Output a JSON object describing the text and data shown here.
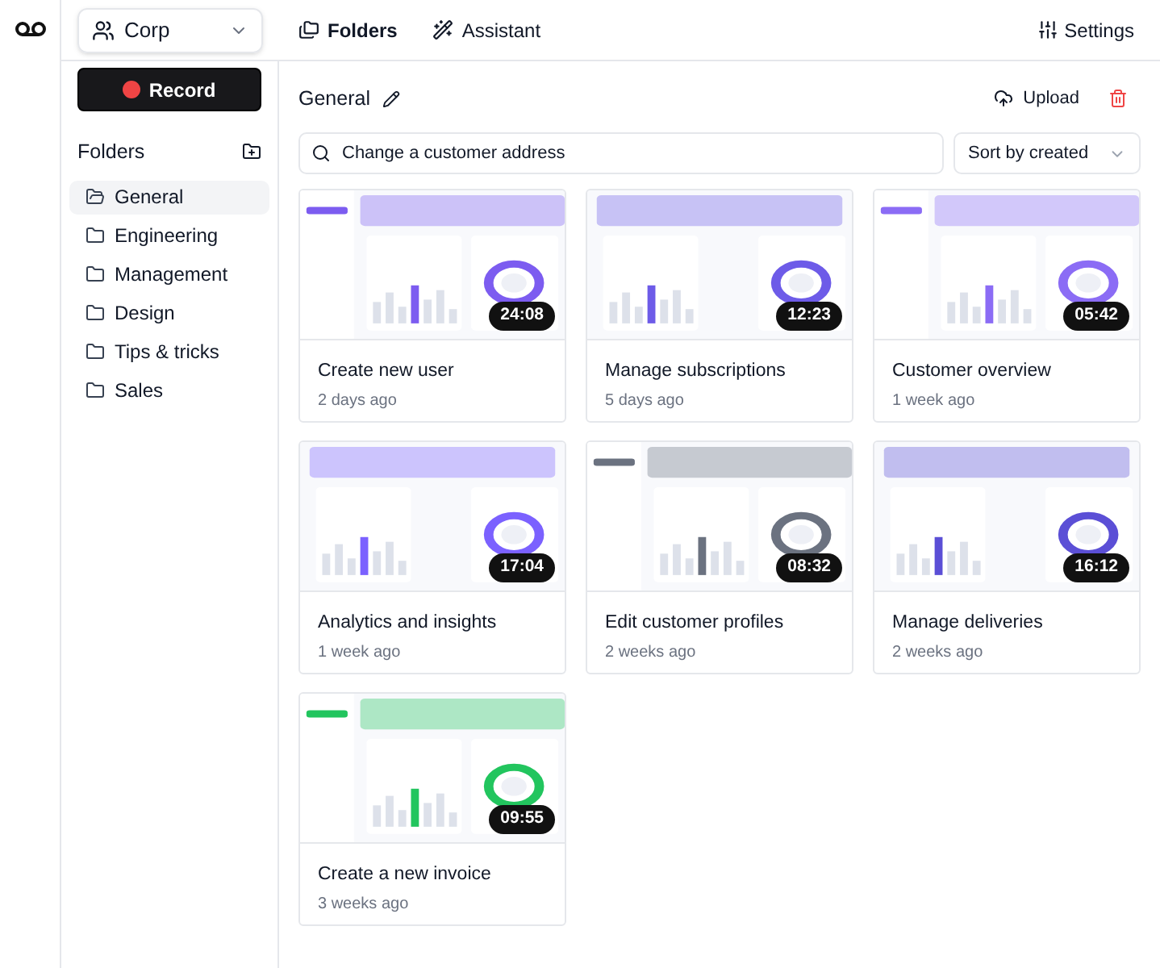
{
  "workspace": {
    "label": "Corp"
  },
  "nav": [
    {
      "label": "Folders",
      "kind": "folders"
    },
    {
      "label": "Assistant",
      "kind": "assistant"
    }
  ],
  "settings": {
    "label": "Settings"
  },
  "record_button": {
    "label": "Record"
  },
  "sidebar": {
    "title": "Folders",
    "items": [
      {
        "label": "General",
        "selected": true
      },
      {
        "label": "Engineering",
        "selected": false
      },
      {
        "label": "Management",
        "selected": false
      },
      {
        "label": "Design",
        "selected": false
      },
      {
        "label": "Tips & tricks",
        "selected": false
      },
      {
        "label": "Sales",
        "selected": false
      }
    ]
  },
  "folder_title": "General",
  "upload": {
    "label": "Upload"
  },
  "search": {
    "value": "Change a customer address"
  },
  "sort": {
    "label": "Sort by created"
  },
  "videos": [
    {
      "title": "Create new user",
      "age": "2 days ago",
      "duration": "24:08"
    },
    {
      "title": "Manage subscriptions",
      "age": "5 days ago",
      "duration": "12:23"
    },
    {
      "title": "Customer overview",
      "age": "1 week ago",
      "duration": "05:42"
    },
    {
      "title": "Analytics and insights",
      "age": "1 week ago",
      "duration": "17:04"
    },
    {
      "title": "Edit customer profiles",
      "age": "2 weeks ago",
      "duration": "08:32"
    },
    {
      "title": "Manage deliveries",
      "age": "2 weeks ago",
      "duration": "16:12"
    },
    {
      "title": "Create a new invoice",
      "age": "3 weeks ago",
      "duration": "09:55"
    }
  ]
}
